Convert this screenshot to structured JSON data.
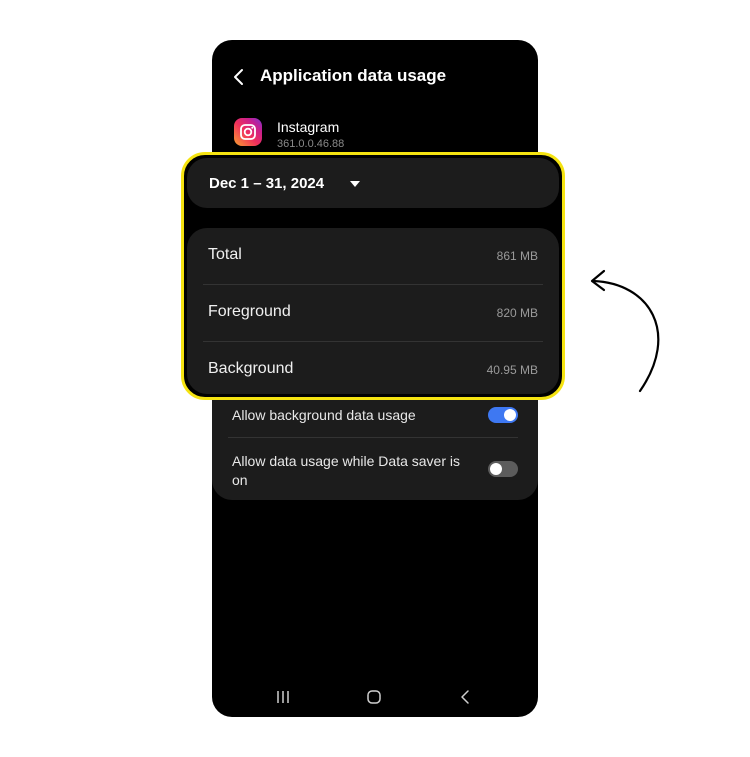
{
  "header": {
    "title": "Application data usage"
  },
  "app": {
    "name": "Instagram",
    "version": "361.0.0.46.88"
  },
  "date_range": {
    "label": "Dec 1 – 31, 2024"
  },
  "usage": {
    "rows": [
      {
        "label": "Total",
        "value": "861 MB"
      },
      {
        "label": "Foreground",
        "value": "820 MB"
      },
      {
        "label": "Background",
        "value": "40.95 MB"
      }
    ]
  },
  "toggles": [
    {
      "label": "Allow background data usage",
      "enabled": true
    },
    {
      "label": "Allow data usage while Data saver is on",
      "enabled": false
    }
  ],
  "colors": {
    "highlight": "#f5e311",
    "switch_on": "#3e78f2",
    "switch_off": "#5c5c5c"
  },
  "icons": {
    "back": "chevron-left-icon",
    "dropdown": "caret-down-icon",
    "nav_recents": "recents-icon",
    "nav_home": "home-icon",
    "nav_back": "back-icon",
    "annotation": "curved-arrow-icon"
  }
}
